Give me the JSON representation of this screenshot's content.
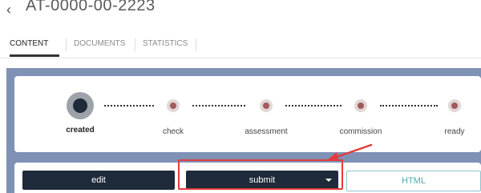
{
  "header": {
    "record_id": "AT-0000-00-2223"
  },
  "tabs": [
    {
      "label": "CONTENT"
    },
    {
      "label": "DOCUMENTS"
    },
    {
      "label": "STATISTICS"
    }
  ],
  "steps": [
    {
      "label": "created",
      "active": true
    },
    {
      "label": "check"
    },
    {
      "label": "assessment"
    },
    {
      "label": "commission"
    },
    {
      "label": "ready"
    }
  ],
  "actions": {
    "edit_label": "edit",
    "submit_label": "submit",
    "html_label": "HTML"
  },
  "colors": {
    "panel": "#7f92b6",
    "dark_button": "#1f2a3a",
    "highlight": "#e33b3b",
    "outline": "#8cc3cf"
  }
}
